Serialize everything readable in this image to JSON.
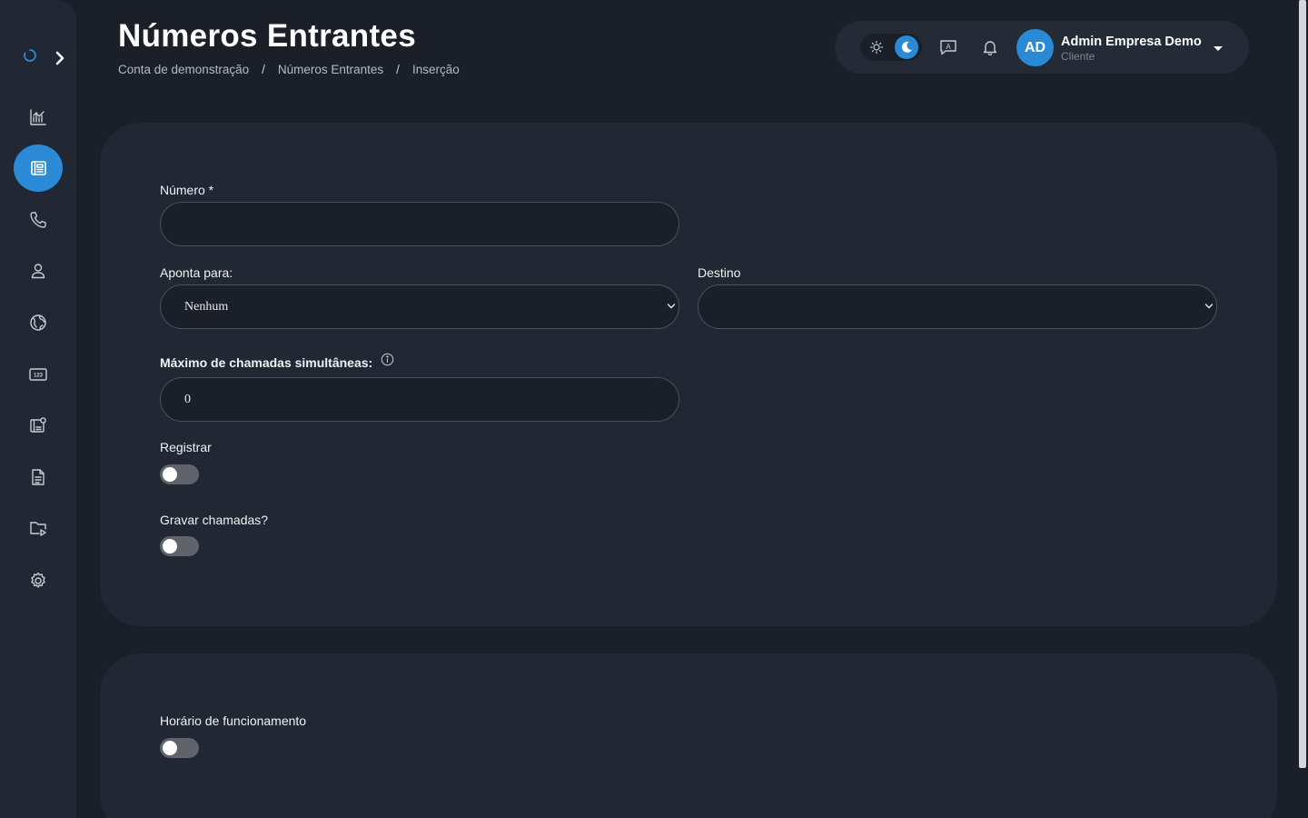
{
  "header": {
    "title": "Números Entrantes",
    "breadcrumb": [
      "Conta de demonstração",
      "Números Entrantes",
      "Inserção"
    ],
    "breadcrumb_separator": "/"
  },
  "user": {
    "initials": "AD",
    "name": "Admin Empresa Demo",
    "role": "Cliente"
  },
  "sidebar": {
    "items": [
      {
        "icon": "chart-icon",
        "active": false
      },
      {
        "icon": "phone-book-icon",
        "active": true
      },
      {
        "icon": "phone-icon",
        "active": false
      },
      {
        "icon": "user-icon",
        "active": false
      },
      {
        "icon": "globe-icon",
        "active": false
      },
      {
        "icon": "numbers-icon",
        "active": false
      },
      {
        "icon": "phone-book-settings-icon",
        "active": false
      },
      {
        "icon": "document-icon",
        "active": false
      },
      {
        "icon": "folder-play-icon",
        "active": false
      },
      {
        "icon": "gear-icon",
        "active": false
      }
    ]
  },
  "form": {
    "numero_label": "Número *",
    "numero_value": "",
    "aponta_label": "Aponta para:",
    "aponta_value": "Nenhum",
    "destino_label": "Destino",
    "destino_value": "",
    "max_label": "Máximo de chamadas simultâneas:",
    "max_value": "0",
    "registrar_label": "Registrar",
    "registrar_on": false,
    "gravar_label": "Gravar chamadas?",
    "gravar_on": false
  },
  "schedule": {
    "horario_label": "Horário de funcionamento",
    "horario_on": false
  },
  "colors": {
    "accent": "#2a8ad6",
    "background": "#1a1f28",
    "card": "#212733"
  }
}
